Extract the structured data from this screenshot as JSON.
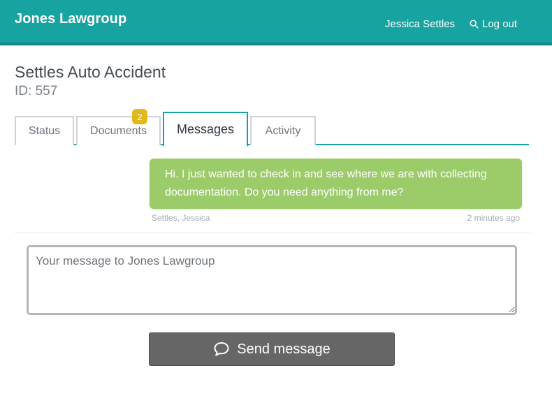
{
  "header": {
    "brand": "Jones Lawgroup",
    "user_name": "Jessica Settles",
    "logout_label": "Log out",
    "logout_icon": "search-icon"
  },
  "case": {
    "title": "Settles Auto Accident",
    "id_label": "ID: 557"
  },
  "tabs": [
    {
      "label": "Status",
      "active": false
    },
    {
      "label": "Documents",
      "active": false,
      "badge": "2"
    },
    {
      "label": "Messages",
      "active": true
    },
    {
      "label": "Activity",
      "active": false
    }
  ],
  "messages": [
    {
      "text": "Hi. I just wanted to check in and see where we are with collecting documentation. Do you need anything from me?",
      "author": "Settles, Jessica",
      "time": "2 minutes ago"
    }
  ],
  "compose": {
    "placeholder": "Your message to Jones Lawgroup",
    "value": "",
    "send_label": "Send message",
    "send_icon": "speech-bubble-icon"
  },
  "colors": {
    "accent": "#17a3a0",
    "message_bubble": "#9ccc6a",
    "badge": "#e3b81b",
    "send_button": "#666666"
  }
}
